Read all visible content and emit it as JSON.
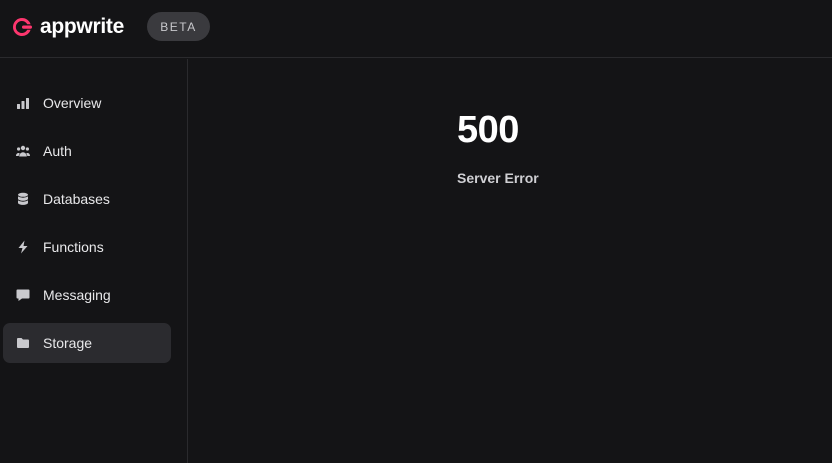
{
  "header": {
    "brand": "appwrite",
    "badge": "BETA",
    "brand_color": "#fd366e"
  },
  "sidebar": {
    "items": [
      {
        "label": "Overview",
        "icon": "bar-chart-icon",
        "active": false
      },
      {
        "label": "Auth",
        "icon": "users-icon",
        "active": false
      },
      {
        "label": "Databases",
        "icon": "database-icon",
        "active": false
      },
      {
        "label": "Functions",
        "icon": "lightning-icon",
        "active": false
      },
      {
        "label": "Messaging",
        "icon": "chat-bubble-icon",
        "active": false
      },
      {
        "label": "Storage",
        "icon": "folder-icon",
        "active": true
      }
    ]
  },
  "main": {
    "error_code": "500",
    "error_message": "Server Error"
  }
}
